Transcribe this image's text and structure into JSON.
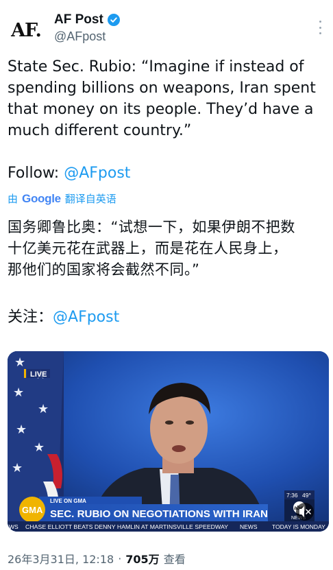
{
  "author": {
    "avatar_text": "AF.",
    "name": "AF Post",
    "handle": "@AFpost"
  },
  "tweet": {
    "lines": [
      "State Sec. Rubio: “Imagine if instead of",
      "spending billions on weapons, Iran spent",
      "that money on its people. They’d have a",
      "much different country.”"
    ],
    "follow_label": "Follow: ",
    "follow_link": "@AFpost"
  },
  "translation": {
    "by_prefix": "由",
    "by_brand": "Google",
    "by_suffix": "翻译自英语",
    "lines": [
      "国务卿鲁比奥：“试想一下，如果伊朗不把数",
      "十亿美元花在武器上，而是花在人民身上，",
      "那他们的国家将会截然不同。”"
    ],
    "follow_label": "关注：",
    "follow_link": "@AFpost"
  },
  "video": {
    "live_badge": "LIVE",
    "network_logo": "GMA",
    "live_on": "LIVE ON GMA",
    "headline": "SEC. RUBIO ON NEGOTIATIONS WITH IRAN",
    "ticker_left": "WS",
    "ticker_main": "CHASE ELLIOTT BEATS DENNY HAMLIN AT MARTINSVILLE SPEEDWAY",
    "ticker_news": "NEWS",
    "ticker_right": "TODAY IS MONDAY",
    "clock": "7:36",
    "temp": "49°",
    "abc_logo": "abc",
    "abc_sub": "NEWS"
  },
  "footer": {
    "timestamp": "26年3月31日, 12:18",
    "sep": "·",
    "views": "705万",
    "views_label": "查看"
  },
  "colors": {
    "accent": "#1d9bf0",
    "secondary_text": "#536471",
    "gma_bar": "#1e4ea8",
    "gma_gold": "#f0b400"
  }
}
